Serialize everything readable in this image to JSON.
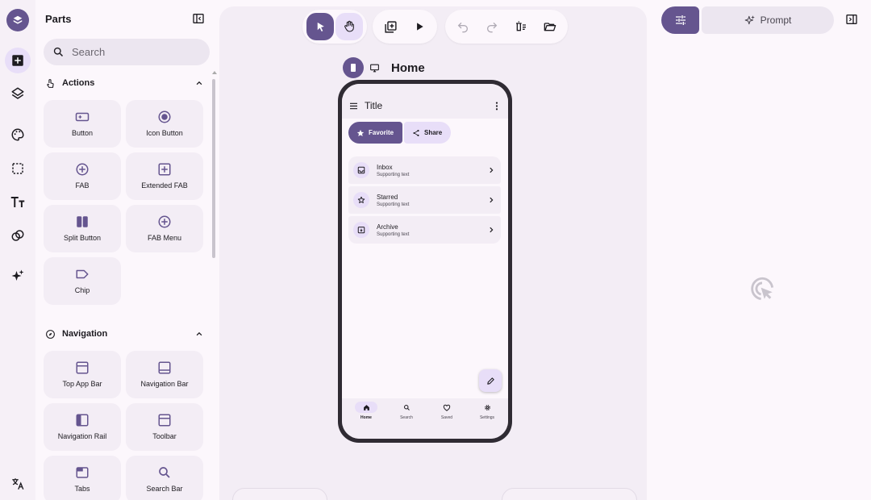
{
  "colors": {
    "primary": "#65558f",
    "secondary_container": "#e8def8",
    "surface": "#fcf7fc",
    "surface_container": "#f3edf5"
  },
  "rail": {
    "items": [
      {
        "icon": "add-box-icon",
        "active": true
      },
      {
        "icon": "layers-icon"
      },
      {
        "icon": "palette-icon"
      },
      {
        "icon": "selection-icon"
      },
      {
        "icon": "text-format-icon"
      },
      {
        "icon": "shape-icon"
      },
      {
        "icon": "sparkle-icon"
      }
    ],
    "bottom_icon": "translate-icon"
  },
  "parts": {
    "title": "Parts",
    "search_placeholder": "Search",
    "sections": [
      {
        "label": "Actions",
        "items": [
          {
            "label": "Button",
            "icon": "button-icon"
          },
          {
            "label": "Icon Button",
            "icon": "radio-icon"
          },
          {
            "label": "FAB",
            "icon": "add-circle-icon"
          },
          {
            "label": "Extended FAB",
            "icon": "add-box-icon"
          },
          {
            "label": "Split Button",
            "icon": "split-button-icon"
          },
          {
            "label": "FAB Menu",
            "icon": "add-circle-icon"
          },
          {
            "label": "Chip",
            "icon": "label-icon"
          }
        ]
      },
      {
        "label": "Navigation",
        "items": [
          {
            "label": "Top App Bar",
            "icon": "top-app-bar-icon"
          },
          {
            "label": "Navigation Bar",
            "icon": "navigation-bar-icon"
          },
          {
            "label": "Navigation Rail",
            "icon": "navigation-rail-icon"
          },
          {
            "label": "Toolbar",
            "icon": "toolbar-icon"
          },
          {
            "label": "Tabs",
            "icon": "tabs-icon"
          },
          {
            "label": "Search Bar",
            "icon": "search-icon"
          }
        ]
      }
    ]
  },
  "canvas": {
    "screen_name": "Home",
    "phone": {
      "app_title": "Title",
      "segmented": {
        "favorite": "Favorite",
        "share": "Share"
      },
      "list": [
        {
          "title": "Inbox",
          "subtitle": "Supporting text",
          "icon": "inbox-icon"
        },
        {
          "title": "Starred",
          "subtitle": "Supporting text",
          "icon": "star-icon"
        },
        {
          "title": "Archive",
          "subtitle": "Supporting text",
          "icon": "archive-icon"
        }
      ],
      "nav": [
        {
          "label": "Home",
          "icon": "home-icon",
          "active": true
        },
        {
          "label": "Search",
          "icon": "search-icon"
        },
        {
          "label": "Saved",
          "icon": "heart-icon"
        },
        {
          "label": "Settings",
          "icon": "gear-icon"
        }
      ]
    }
  },
  "right_panel": {
    "prompt_label": "Prompt",
    "empty_state_icon": "cursor-click-icon"
  }
}
